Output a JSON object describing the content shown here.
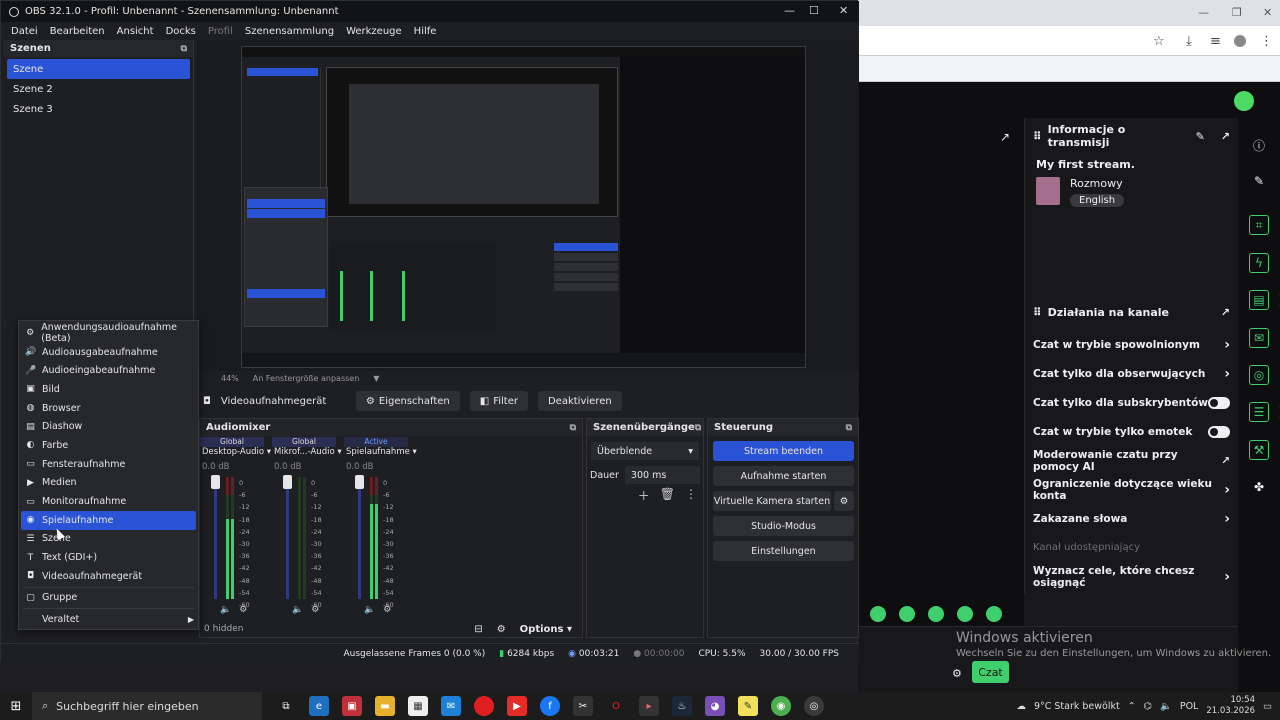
{
  "obs": {
    "title": "OBS 32.1.0 - Profil: Unbenannt - Szenensammlung: Unbenannt",
    "window_controls": [
      "—",
      "☐",
      "✕"
    ],
    "menu": [
      "Datei",
      "Bearbeiten",
      "Ansicht",
      "Docks",
      "Profil",
      "Szenensammlung",
      "Werkzeuge",
      "Hilfe"
    ],
    "scenes_title": "Szenen",
    "scenes": [
      "Szene",
      "Szene 2",
      "Szene 3"
    ],
    "zoom": "44%",
    "fit_label": "An Fenstergröße anpassen",
    "source_selected": "Videoaufnahmegerät",
    "properties_label": "Eigenschaften",
    "filter_label": "Filter",
    "deactivate_label": "Deaktivieren",
    "mixer_title": "Audiomixer",
    "mixer_tabs": [
      "Global",
      "Global",
      "Active"
    ],
    "channels": [
      {
        "name": "Desktop-Audio",
        "db": "0.0 dB"
      },
      {
        "name": "Mikrof...-Audio",
        "db": "0.0 dB"
      },
      {
        "name": "Spielaufnahme",
        "db": "0.0 dB"
      }
    ],
    "scale": [
      "0",
      "-6",
      "-12",
      "-18",
      "-24",
      "-30",
      "-36",
      "-42",
      "-48",
      "-54",
      "-60"
    ],
    "hidden_label": "0 hidden",
    "options_label": "Options",
    "transitions_title": "Szenenübergänge",
    "transition_value": "Überblende",
    "duration_label": "Dauer",
    "duration_value": "300 ms",
    "controls_title": "Steuerung",
    "controls": [
      "Stream beenden",
      "Aufnahme starten",
      "Virtuelle Kamera starten",
      "Studio-Modus",
      "Einstellungen"
    ],
    "status": {
      "dropped": "Ausgelassene Frames 0 (0.0 %)",
      "bitrate": "6284 kbps",
      "stream_time": "00:03:21",
      "rec_time": "00:00:00",
      "cpu": "CPU: 5.5%",
      "fps": "30.00 / 30.00 FPS"
    }
  },
  "context_menu": {
    "items": [
      {
        "label": "Anwendungsaudioaufnahme (Beta)",
        "icon": "⚙"
      },
      {
        "label": "Audioausgabeaufnahme",
        "icon": "🔊"
      },
      {
        "label": "Audioeingabeaufnahme",
        "icon": "🎤"
      },
      {
        "label": "Bild",
        "icon": "▣"
      },
      {
        "label": "Browser",
        "icon": "◍"
      },
      {
        "label": "Diashow",
        "icon": "▤"
      },
      {
        "label": "Farbe",
        "icon": "◐"
      },
      {
        "label": "Fensteraufnahme",
        "icon": "▭"
      },
      {
        "label": "Medien",
        "icon": "▶"
      },
      {
        "label": "Monitoraufnahme",
        "icon": "▭"
      },
      {
        "label": "Spielaufnahme",
        "icon": "◉"
      },
      {
        "label": "Szene",
        "icon": "☰"
      },
      {
        "label": "Text (GDI+)",
        "icon": "T"
      },
      {
        "label": "Videoaufnahmegerät",
        "icon": "◘"
      }
    ],
    "group": {
      "label": "Gruppe",
      "icon": "▢"
    },
    "legacy": {
      "label": "Veraltet",
      "arrow": "▶"
    }
  },
  "twitch": {
    "stream_info_title": "Informacje o transmisji",
    "stream_title": "My first stream.",
    "category": "Rozmowy",
    "tag": "English",
    "actions_title": "Działania na kanale",
    "actions": [
      {
        "label": "Czat w trybie spowolnionym",
        "type": "arrow"
      },
      {
        "label": "Czat tylko dla obserwujących",
        "type": "arrow"
      },
      {
        "label": "Czat tylko dla subskrybentów",
        "type": "toggle"
      },
      {
        "label": "Czat w trybie tylko emotek",
        "type": "toggle"
      },
      {
        "label": "Moderowanie czatu przy pomocy AI",
        "type": "external"
      },
      {
        "label": "Ograniczenie dotyczące wieku konta",
        "type": "arrow"
      },
      {
        "label": "Zakazane słowa",
        "type": "arrow"
      }
    ],
    "shared_label": "Kanał udostępniający",
    "goals_label": "Wyznacz cele, które chcesz osiągnąć",
    "chat_button": "Czat"
  },
  "windows": {
    "activate_title": "Windows aktivieren",
    "activate_text": "Wechseln Sie zu den Einstellungen, um Windows zu aktivieren.",
    "search_placeholder": "Suchbegriff hier eingeben",
    "weather": "9°C  Stark bewölkt",
    "lang": "POL",
    "time": "10:54",
    "date": "21.03.2026"
  }
}
